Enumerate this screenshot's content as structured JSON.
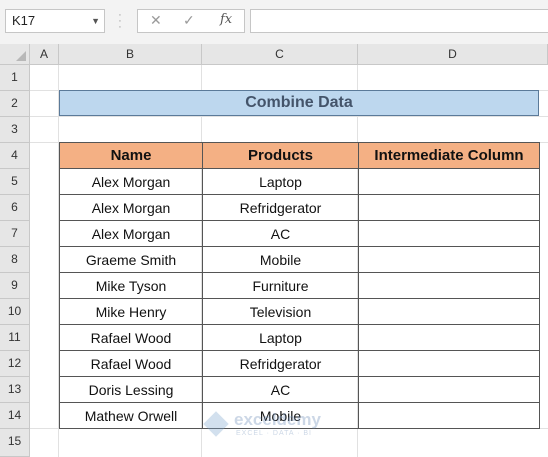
{
  "formula_bar": {
    "name_box": "K17",
    "dropdown_icon": "chevron-down-icon",
    "cancel_icon": "✕",
    "enter_icon": "✓",
    "fx_label": "fx",
    "formula_value": ""
  },
  "columns": [
    "A",
    "B",
    "C",
    "D"
  ],
  "rows": [
    "1",
    "2",
    "3",
    "4",
    "5",
    "6",
    "7",
    "8",
    "9",
    "10",
    "11",
    "12",
    "13",
    "14",
    "15"
  ],
  "sheet": {
    "title": "Combine Data",
    "headers": [
      "Name",
      "Products",
      "Intermediate Column"
    ],
    "data": [
      [
        "Alex Morgan",
        "Laptop",
        ""
      ],
      [
        "Alex Morgan",
        "Refridgerator",
        ""
      ],
      [
        "Alex Morgan",
        "AC",
        ""
      ],
      [
        "Graeme Smith",
        "Mobile",
        ""
      ],
      [
        "Mike Tyson",
        "Furniture",
        ""
      ],
      [
        "Mike Henry",
        "Television",
        ""
      ],
      [
        "Rafael Wood",
        "Laptop",
        ""
      ],
      [
        "Rafael Wood",
        "Refridgerator",
        ""
      ],
      [
        "Doris Lessing",
        "AC",
        ""
      ],
      [
        "Mathew Orwell",
        "Mobile",
        ""
      ]
    ]
  },
  "watermark": {
    "name": "exceldemy",
    "tagline": "EXCEL · DATA · BI"
  },
  "colors": {
    "title_fill": "#bdd7ee",
    "header_fill": "#f4b084",
    "title_text": "#44546a"
  }
}
